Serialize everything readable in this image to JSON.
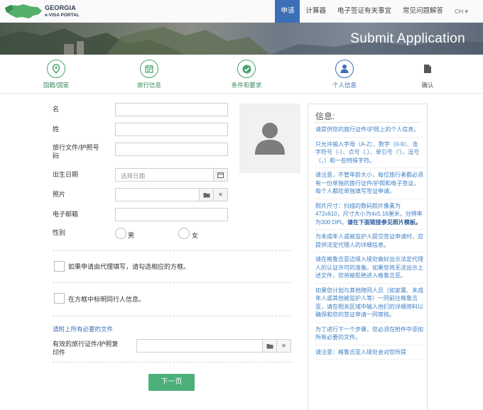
{
  "brand": {
    "name": "GEORGIA",
    "subtitle": "e-VISA PORTAL"
  },
  "nav": {
    "items": [
      "申请",
      "计算器",
      "电子签证有关事宜",
      "常见问题解答"
    ],
    "language": "CH ▾"
  },
  "banner": {
    "title": "Submit Application"
  },
  "steps": [
    {
      "label": "国籍/国家",
      "icon": "map-pin-icon"
    },
    {
      "label": "旅行信息",
      "icon": "calendar-icon"
    },
    {
      "label": "条件和要求",
      "icon": "check-icon"
    },
    {
      "label": "个人信息",
      "icon": "user-icon"
    },
    {
      "label": "确认",
      "icon": "document-icon"
    }
  ],
  "form": {
    "first_name_label": "名",
    "last_name_label": "姓",
    "passport_label": "旅行文件/护照号码",
    "birthdate_label": "出生日期",
    "birthdate_placeholder": "选择日期",
    "photo_label": "照片",
    "email_label": "电子邮箱",
    "gender_label": "性别",
    "gender_male": "男",
    "gender_female": "女",
    "proxy_checkbox_label": "如果申请由代理填写，请勾选相应的方框。",
    "companion_checkbox_label": "在方框中标明同行人信息。",
    "upload_link": "请附上所有必要的文件",
    "passport_copy_label": "有效的旅行证件/护照复印件",
    "next_button": "下一页"
  },
  "info": {
    "title": "信息:",
    "paragraphs": [
      "请提供您的旅行证件/护照上的个人信息。",
      "只允许输入字母（A-Z）、数字（0-9）、连字符号（-）、点号（.）、单引号（'）、逗号（，）和一些特殊字符。",
      "请注意，不管年龄大小，每位旅行者都必须有一份单独的旅行证件/护照和电子签证。每个人都应单独填写签证申请。",
      "照片尺寸：扫描的数码照片像素为472x610，尺寸大小为4x5.16厘米，分辨率为300 DPI。",
      "为未成年人或被监护人提交签证申请时，应提供法定代理人的详细信息。",
      "请在格鲁吉亚边境入境处做好出示法定代理人的认证许可的准备。如果您将无法出示上述文件，您将被拒绝进入格鲁吉亚。",
      "如果您计划与其他随同人员（如家属、未成年人或其他被监护人等）一同前往格鲁吉亚，请在相关区域中输入他们的详细资料以确保和您的签证申请一同审核。",
      "为了进行下一个步骤，您必须在附件中添加所有必要的文件。",
      "请注意：格鲁吉亚入境处会对您所提"
    ],
    "photo_link": "请在下面链接参见照片模板。"
  }
}
